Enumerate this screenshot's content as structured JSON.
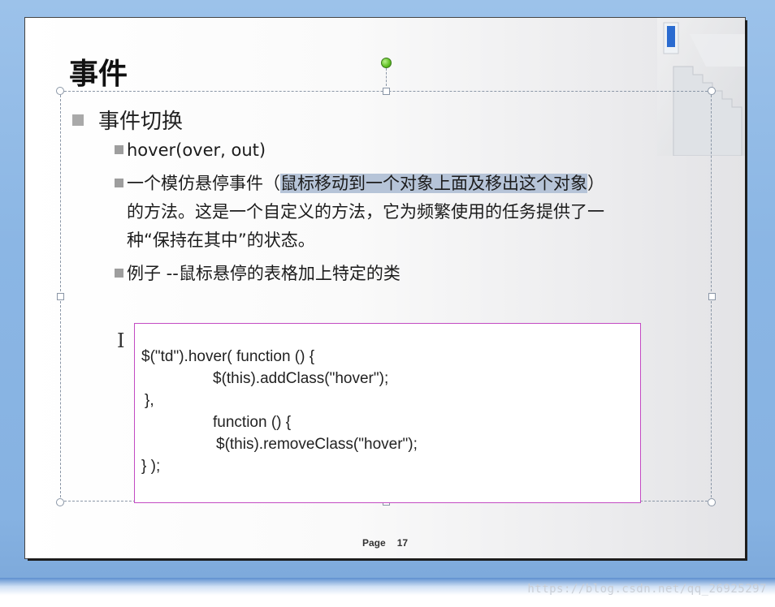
{
  "slide": {
    "title": "事件",
    "bullet": "事件切换",
    "sub_items": [
      {
        "text": "hover(over, out)"
      },
      {
        "pre": "一个模仿悬停事件（",
        "highlight": "鼠标移动到一个对象上面及移出这个对象",
        "post": "）",
        "line2": "的方法。这是一个自定义的方法，它为频繁使用的任务提供了一",
        "line3": "种“保持在其中”的状态。"
      },
      {
        "text": "例子 --鼠标悬停的表格加上特定的类"
      }
    ],
    "code_lines": [
      "$(\"td\").hover( function () {",
      "$(this).addClass(\"hover\");",
      "},",
      "function () {",
      "$(this).removeClass(\"hover\");",
      "} );"
    ],
    "footer": {
      "page_label": "Page",
      "page_number": "17"
    }
  },
  "watermark": "https://blog.csdn.net/qq_26925297",
  "colors": {
    "highlight": "#b6c4d8",
    "code_border": "#c34bc3",
    "rotate_handle": "#5fbf22"
  },
  "icons": [
    "text-cursor-icon",
    "rotate-handle-icon",
    "bullet-square-icon",
    "stairs-decoration"
  ]
}
